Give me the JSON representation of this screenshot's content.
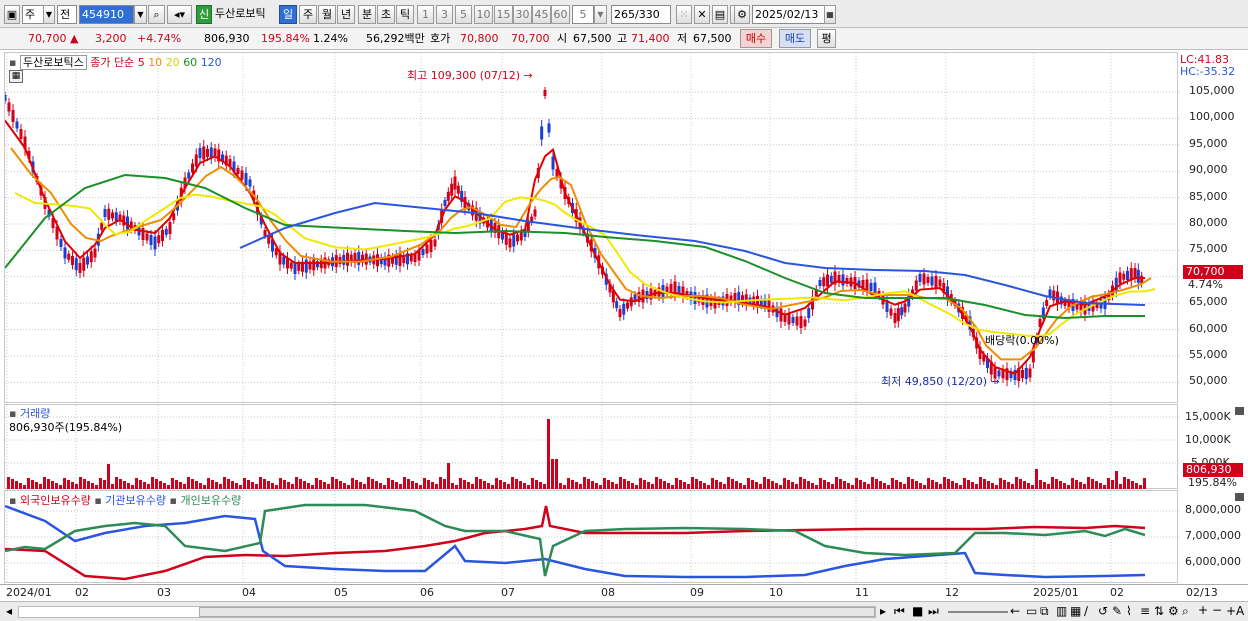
{
  "toolbar": {
    "market_type": "주",
    "scope": "전",
    "code": "454910",
    "stock_name": "두산로보틱",
    "new_badge": "신",
    "periods": [
      "일",
      "주",
      "월",
      "년",
      "분",
      "초",
      "틱"
    ],
    "selected_period": "일",
    "intervals": [
      "1",
      "3",
      "5",
      "10",
      "15",
      "30",
      "45",
      "60"
    ],
    "interval_value": "5",
    "count": "265",
    "count_total": "/330",
    "date": "2025/02/13"
  },
  "quote": {
    "price": "70,700",
    "change": "3,200",
    "change_pct": "+4.74%",
    "volume": "806,930",
    "volume_ratio": "195.84%",
    "turnover": "1.24%",
    "amount": "56,292백만",
    "ask_label": "호가",
    "ask": "70,800",
    "bid": "70,700",
    "open_label": "시",
    "open": "67,500",
    "high_label": "고",
    "high": "71,400",
    "low_label": "저",
    "low": "67,500",
    "buy": "매수",
    "sell": "매도",
    "eval": "평"
  },
  "main_legend": {
    "name": "두산로보틱스",
    "desc": "종가 단순",
    "ma": [
      {
        "label": "5",
        "color": "#e00000"
      },
      {
        "label": "10",
        "color": "#f08c00"
      },
      {
        "label": "20",
        "color": "#e8e000"
      },
      {
        "label": "60",
        "color": "#1a8f2a"
      },
      {
        "label": "120",
        "color": "#2a55e0"
      }
    ]
  },
  "corner": {
    "lc": "LC:41.83",
    "hc": "HC:-35.32"
  },
  "annotations": {
    "high": "최고 109,300 (07/12)",
    "low": "최저 49,850 (12/20)",
    "dividend": "배당락(0.00%)"
  },
  "price_axis": [
    "105,000",
    "100,000",
    "95,000",
    "90,000",
    "85,000",
    "80,000",
    "75,000",
    "70,000",
    "65,000",
    "60,000",
    "55,000",
    "50,000"
  ],
  "price_tag": {
    "value": "70,700",
    "pct": "4.74%"
  },
  "volume_panel": {
    "title": "거래량",
    "info": "806,930주(195.84%)",
    "axis": [
      "15,000K",
      "10,000K",
      "5,000K"
    ],
    "tag": "806,930",
    "tag_pct": "195.84%"
  },
  "holdings_panel": {
    "series": [
      {
        "name": "외국인보유수량",
        "color": "#d0021b"
      },
      {
        "name": "기관보유수량",
        "color": "#2a55e0"
      },
      {
        "name": "개인보유수량",
        "color": "#2e8b57"
      }
    ],
    "axis": [
      "8,000,000",
      "7,000,000",
      "6,000,000"
    ]
  },
  "x_axis": [
    "2024/01",
    "02",
    "03",
    "04",
    "05",
    "06",
    "07",
    "08",
    "09",
    "10",
    "11",
    "12",
    "2025/01",
    "02"
  ],
  "x_end": "02/13"
}
